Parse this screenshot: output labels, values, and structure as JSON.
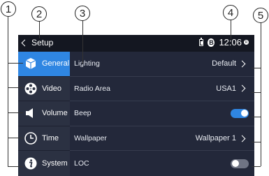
{
  "callouts": [
    "1",
    "2",
    "3",
    "4",
    "5"
  ],
  "header": {
    "back_label": "Setup",
    "time": "12:06",
    "bluetooth_symbol": "B",
    "reg_symbol": "R"
  },
  "sidebar": {
    "items": [
      {
        "label": "General",
        "icon": "cube-icon",
        "active": true
      },
      {
        "label": "Video",
        "icon": "film-reel-icon"
      },
      {
        "label": "Volume",
        "icon": "speaker-icon"
      },
      {
        "label": "Time",
        "icon": "clock-icon"
      },
      {
        "label": "System",
        "icon": "info-icon"
      }
    ]
  },
  "settings": {
    "rows": [
      {
        "label": "Lighting",
        "value": "Default",
        "control": "arrow"
      },
      {
        "label": "Radio Area",
        "value": "USA1",
        "control": "arrow"
      },
      {
        "label": "Beep",
        "control": "toggle",
        "state": "on"
      },
      {
        "label": "Wallpaper",
        "value": "Wallpaper 1",
        "control": "arrow"
      },
      {
        "label": "LOC",
        "control": "toggle",
        "state": "off"
      }
    ]
  },
  "colors": {
    "accent": "#2f86e2",
    "screen_bg": "#23283a",
    "sidebar_bg": "#2b3142",
    "statusbar_bg": "#141721"
  }
}
